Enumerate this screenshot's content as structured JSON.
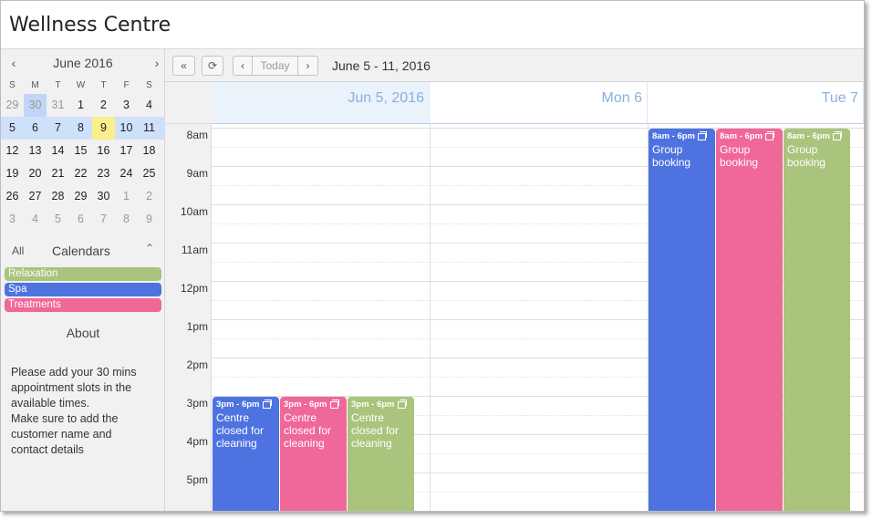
{
  "app": {
    "title": "Wellness Centre"
  },
  "mini_calendar": {
    "month_label": "June 2016",
    "prev_icon": "chevron-left-icon",
    "next_icon": "chevron-right-icon",
    "dow": [
      "S",
      "M",
      "T",
      "W",
      "T",
      "F",
      "S"
    ],
    "weeks": [
      [
        "29",
        "30",
        "31",
        "1",
        "2",
        "3",
        "4"
      ],
      [
        "5",
        "6",
        "7",
        "8",
        "9",
        "10",
        "11"
      ],
      [
        "12",
        "13",
        "14",
        "15",
        "16",
        "17",
        "18"
      ],
      [
        "19",
        "20",
        "21",
        "22",
        "23",
        "24",
        "25"
      ],
      [
        "26",
        "27",
        "28",
        "29",
        "30",
        "1",
        "2"
      ],
      [
        "3",
        "4",
        "5",
        "6",
        "7",
        "8",
        "9"
      ]
    ]
  },
  "calendars": {
    "all_label": "All",
    "title": "Calendars",
    "collapse_icon": "chevron-up-icon",
    "items": [
      {
        "label": "Relaxation",
        "color": "#a9c47c"
      },
      {
        "label": "Spa",
        "color": "#4e73e0"
      },
      {
        "label": "Treatments",
        "color": "#f0679a"
      }
    ]
  },
  "about": {
    "title": "About",
    "text_lines": [
      "Please add your 30 mins",
      "appointment slots in the",
      "available times.",
      "Make sure to add the",
      "customer name and",
      "contact details"
    ]
  },
  "toolbar": {
    "first_icon": "double-chevron-left-icon",
    "refresh_icon": "refresh-icon",
    "prev_icon": "chevron-left-icon",
    "today_label": "Today",
    "next_icon": "chevron-right-icon",
    "range_label": "June 5 - 11, 2016"
  },
  "day_columns": [
    {
      "label": "Jun 5, 2016"
    },
    {
      "label": "Mon 6"
    },
    {
      "label": "Tue 7"
    }
  ],
  "hours": [
    "8am",
    "9am",
    "10am",
    "11am",
    "12pm",
    "1pm",
    "2pm",
    "3pm",
    "4pm",
    "5pm"
  ],
  "events": [
    {
      "day": 0,
      "lane": 0,
      "start": "3pm",
      "time": "3pm - 6pm",
      "title_lines": [
        "Centre",
        "closed for",
        "cleaning"
      ],
      "color": "#4e73e0"
    },
    {
      "day": 0,
      "lane": 1,
      "start": "3pm",
      "time": "3pm - 6pm",
      "title_lines": [
        "Centre",
        "closed for",
        "cleaning"
      ],
      "color": "#f0679a"
    },
    {
      "day": 0,
      "lane": 2,
      "start": "3pm",
      "time": "3pm - 6pm",
      "title_lines": [
        "Centre",
        "closed for",
        "cleaning"
      ],
      "color": "#a9c47c"
    },
    {
      "day": 2,
      "lane": 0,
      "start": "8am",
      "time": "8am - 6pm",
      "title_lines": [
        "Group",
        "booking"
      ],
      "color": "#4e73e0"
    },
    {
      "day": 2,
      "lane": 1,
      "start": "8am",
      "time": "8am - 6pm",
      "title_lines": [
        "Group",
        "booking"
      ],
      "color": "#f0679a"
    },
    {
      "day": 2,
      "lane": 2,
      "start": "8am",
      "time": "8am - 6pm",
      "title_lines": [
        "Group",
        "booking"
      ],
      "color": "#a9c47c"
    }
  ],
  "colors": {
    "accent": "#4e73e0",
    "today_highlight": "#fbef89",
    "header_text": "#8ab0df"
  }
}
